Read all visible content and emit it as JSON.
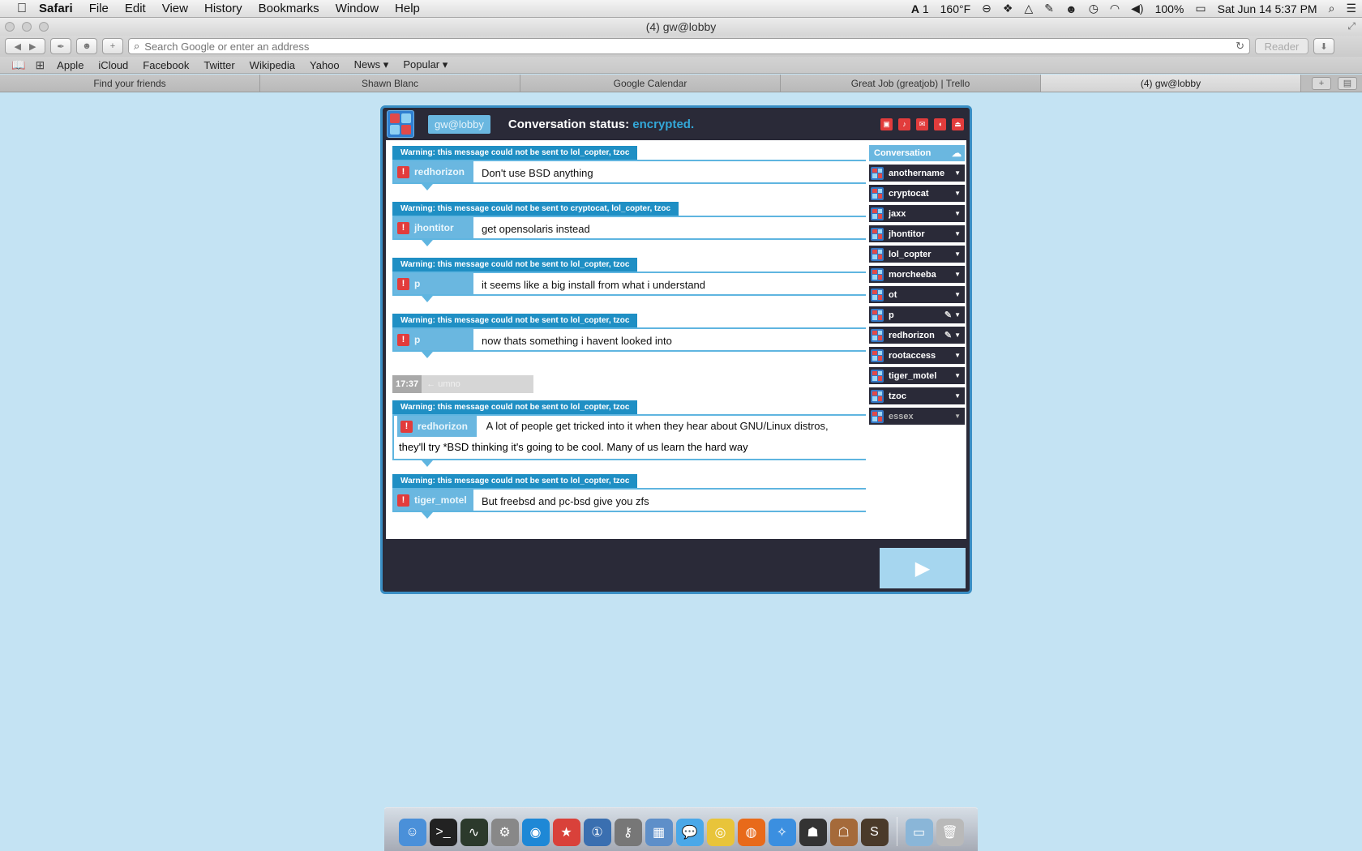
{
  "menubar": {
    "apple": "",
    "app": "Safari",
    "items": [
      "File",
      "Edit",
      "View",
      "History",
      "Bookmarks",
      "Window",
      "Help"
    ],
    "status": {
      "adobe": "1",
      "temp": "160°F",
      "battery": "100%",
      "datetime": "Sat Jun 14  5:37 PM"
    }
  },
  "browser": {
    "window_title": "(4) gw@lobby",
    "address_placeholder": "Search Google or enter an address",
    "reader_label": "Reader",
    "bookmarks": [
      "Apple",
      "iCloud",
      "Facebook",
      "Twitter",
      "Wikipedia",
      "Yahoo",
      "News ▾",
      "Popular ▾"
    ],
    "tabs": [
      "Find your friends",
      "Shawn Blanc",
      "Google Calendar",
      "Great Job (greatjob) | Trello",
      "(4) gw@lobby"
    ]
  },
  "chat": {
    "nick": "gw@lobby",
    "status_label": "Conversation status:",
    "status_value": "encrypted.",
    "messages": [
      {
        "warning": "Warning: this message could not be sent to lol_copter, tzoc",
        "user": "redhorizon",
        "text": "Don't use BSD anything"
      },
      {
        "warning": "Warning: this message could not be sent to cryptocat, lol_copter, tzoc",
        "user": "jhontitor",
        "text": "get opensolaris instead"
      },
      {
        "warning": "Warning: this message could not be sent to lol_copter, tzoc",
        "user": "p",
        "text": "it seems like a big install from what i understand"
      },
      {
        "warning": "Warning: this message could not be sent to lol_copter, tzoc",
        "user": "p",
        "text": "now thats something i havent looked into"
      },
      {
        "warning": "Warning: this message could not be sent to lol_copter, tzoc",
        "user": "redhorizon",
        "text": "A lot of people get tricked into it when they hear about GNU/Linux distros,",
        "text2": "they'll try *BSD thinking it's going to be cool. Many of us learn the hard way"
      },
      {
        "warning": "Warning: this message could not be sent to lol_copter, tzoc",
        "user": "tiger_motel",
        "text": "But freebsd and pc-bsd give you zfs"
      }
    ],
    "presence": {
      "time": "17:37",
      "text": "← umno"
    },
    "buddy_header": "Conversation",
    "buddies": [
      "anothername",
      "cryptocat",
      "jaxx",
      "jhontitor",
      "lol_copter",
      "morcheeba",
      "ot",
      "p",
      "redhorizon",
      "rootaccess",
      "tiger_motel",
      "tzoc",
      "essex"
    ],
    "input_value": ""
  },
  "dock": {
    "apps": [
      "finder-icon",
      "terminal-icon",
      "activity-monitor-icon",
      "system-preferences-icon",
      "tweetbot-icon",
      "instapaper-icon",
      "1password-icon",
      "keychain-icon",
      "preview-icon",
      "messages-icon",
      "chrome-icon",
      "firefox-icon",
      "safari-icon",
      "cryptocat-icon",
      "cyberduck-icon",
      "sublime-icon",
      "downloads-folder-icon",
      "trash-icon"
    ]
  }
}
